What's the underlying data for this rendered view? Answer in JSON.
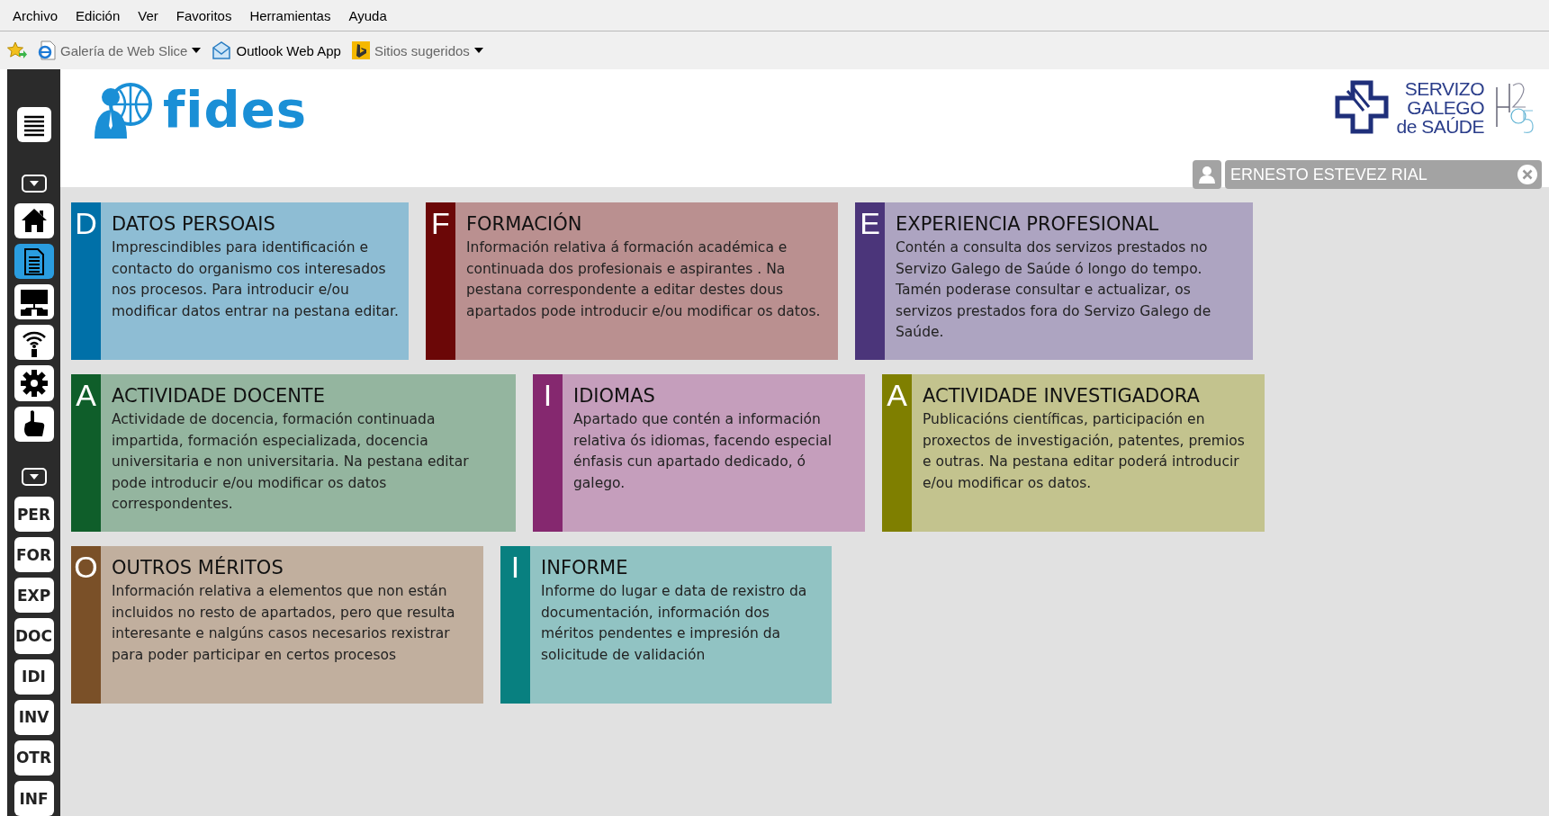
{
  "menu_bar": [
    "Archivo",
    "Edición",
    "Ver",
    "Favoritos",
    "Herramientas",
    "Ayuda"
  ],
  "favorites_bar": [
    {
      "kind": "ie",
      "label": "Galería de Web Slice",
      "dropdown": true
    },
    {
      "kind": "outlook",
      "label": "Outlook Web App",
      "dropdown": false
    },
    {
      "kind": "bing",
      "label": "Sitios sugeridos",
      "dropdown": true
    }
  ],
  "sidebar": {
    "icon_items": [
      {
        "kind": "home",
        "selected": false
      },
      {
        "kind": "document",
        "selected": true
      },
      {
        "kind": "sitemap",
        "selected": false
      },
      {
        "kind": "info",
        "selected": false
      },
      {
        "kind": "settings",
        "selected": false
      },
      {
        "kind": "hand",
        "selected": false
      }
    ],
    "section_items": [
      {
        "label": "PER",
        "selected": false
      },
      {
        "label": "FOR",
        "selected": false
      },
      {
        "label": "EXP",
        "selected": false
      },
      {
        "label": "DOC",
        "selected": false
      },
      {
        "label": "IDI",
        "selected": false
      },
      {
        "label": "INV",
        "selected": false
      },
      {
        "label": "OTR",
        "selected": false
      },
      {
        "label": "INF",
        "selected": false
      }
    ]
  },
  "header": {
    "app_name": "fides",
    "org_name_lines": [
      "SERVIZO",
      "GALEGO",
      "de SAÚDE"
    ],
    "user_name": "ERNESTO ESTEVEZ RIAL"
  },
  "card_rows": [
    {
      "cards": [
        {
          "letter": "D",
          "title": "DATOS PERSOAIS",
          "text": "Imprescindibles para identificación e contacto do organismo cos interesados nos procesos. Para introducir e/ou modificar datos entrar na pestana editar.",
          "color": "#0070a8"
        },
        {
          "letter": "F",
          "title": "FORMACIÓN",
          "text": "Información relativa á formación académica e continuada dos profesionais e aspirantes . Na pestana correspondente a editar destes dous apartados pode introducir e/ou modificar os datos.",
          "color": "#6b0707"
        },
        {
          "letter": "E",
          "title": "EXPERIENCIA PROFESIONAL",
          "text": "Contén a consulta dos servizos prestados no Servizo Galego de Saúde ó longo do tempo. Tamén poderase consultar e actualizar, os servizos prestados fora do Servizo Galego de Saúde.",
          "color": "#4b357a"
        }
      ]
    },
    {
      "cards": [
        {
          "letter": "A",
          "title": "ACTIVIDADE DOCENTE",
          "text": "Actividade de docencia, formación continuada impartida, formación especializada, docencia universitaria e non universitaria. Na pestana editar pode introducir e/ou modificar os datos correspondentes.",
          "color": "#0f5e2a"
        },
        {
          "letter": "I",
          "title": "IDIOMAS",
          "text": "Apartado que contén a información relativa ós idiomas, facendo especial énfasis cun apartado dedicado, ó galego.",
          "color": "#85286f"
        },
        {
          "letter": "A",
          "title": "ACTIVIDADE INVESTIGADORA",
          "text": "Publicacións científicas, participación en proxectos de investigación, patentes, premios e outras. Na pestana editar poderá introducir e/ou modificar os datos.",
          "color": "#7f7f00"
        }
      ]
    },
    {
      "cards": [
        {
          "letter": "O",
          "title": "OUTROS MÉRITOS",
          "text": "Información relativa a elementos que non están incluidos no resto de apartados, pero que resulta interesante e nalgúns casos necesarios rexistrar para poder participar en certos procesos",
          "color": "#7a5028"
        },
        {
          "letter": "I",
          "title": "INFORME",
          "text": "Informe do lugar e data de rexistro da documentación, información dos méritos pendentes e impresión da solicitude de validación",
          "color": "#088080"
        }
      ]
    }
  ]
}
